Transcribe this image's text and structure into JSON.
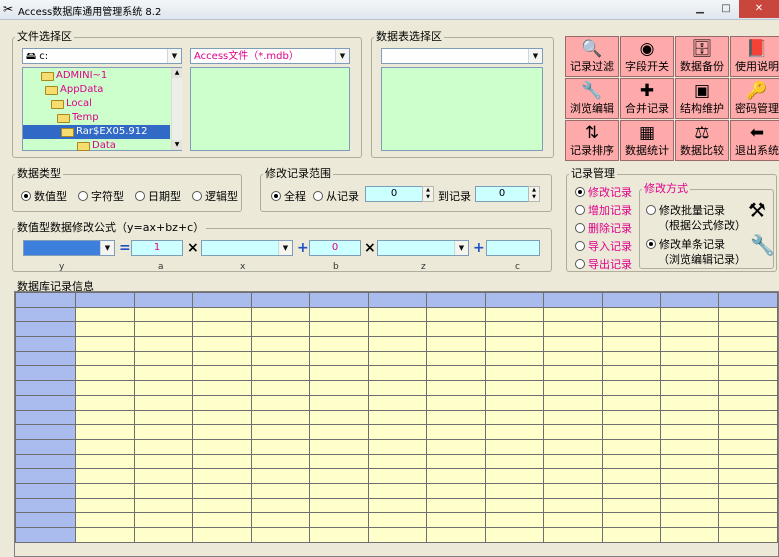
{
  "window": {
    "title": "Access数据库通用管理系统 8.2"
  },
  "file_area": {
    "title": "文件选择区",
    "drive": "c:",
    "filter": "Access文件（*.mdb）",
    "tree": [
      "ADMINI~1",
      "AppData",
      "Local",
      "Temp",
      "Rar$EX05.912",
      "Data"
    ]
  },
  "table_area": {
    "title": "数据表选择区",
    "selected": ""
  },
  "toolbar": {
    "buttons": [
      {
        "label": "记录过滤",
        "icon": "magnifier-icon",
        "glyph": "🔍"
      },
      {
        "label": "字段开关",
        "icon": "toggle-switch-icon",
        "glyph": "◉"
      },
      {
        "label": "数据备份",
        "icon": "database-backup-icon",
        "glyph": "🗄"
      },
      {
        "label": "使用说明",
        "icon": "help-book-icon",
        "glyph": "📕"
      },
      {
        "label": "浏览编辑",
        "icon": "tools-icon",
        "glyph": "🔧"
      },
      {
        "label": "合并记录",
        "icon": "merge-arrows-icon",
        "glyph": "✚"
      },
      {
        "label": "结构维护",
        "icon": "structure-icon",
        "glyph": "▣"
      },
      {
        "label": "密码管理",
        "icon": "key-icon",
        "glyph": "🔑"
      },
      {
        "label": "记录排序",
        "icon": "sort-icon",
        "glyph": "⇅"
      },
      {
        "label": "数据统计",
        "icon": "calculator-icon",
        "glyph": "▦"
      },
      {
        "label": "数据比较",
        "icon": "compare-icon",
        "glyph": "⚖"
      },
      {
        "label": "退出系统",
        "icon": "exit-door-icon",
        "glyph": "⬅"
      }
    ]
  },
  "data_type": {
    "title": "数据类型",
    "options": [
      "数值型",
      "字符型",
      "日期型",
      "逻辑型"
    ],
    "selected": "数值型"
  },
  "modify_range": {
    "title": "修改记录范围",
    "all_label": "全程",
    "from_label": "从记录",
    "to_label": "到记录",
    "from_value": "0",
    "to_value": "0"
  },
  "formula": {
    "title": "数值型数据修改公式（y=ax+bz+c）",
    "a_value": "1",
    "b_value": "0",
    "c_value": "",
    "labels": [
      "y",
      "a",
      "x",
      "b",
      "z",
      "c"
    ],
    "equals": "=",
    "times": "×",
    "plus": "+"
  },
  "record_mgmt": {
    "title": "记录管理",
    "options": [
      "修改记录",
      "增加记录",
      "删除记录",
      "导入记录",
      "导出记录"
    ],
    "selected": "修改记录"
  },
  "modify_mode": {
    "title": "修改方式",
    "batch_label": "修改批量记录",
    "batch_sub": "（根据公式修改）",
    "single_label": "修改单条记录",
    "single_sub": "（浏览编辑记录）"
  },
  "records": {
    "title": "数据库记录信息"
  },
  "colors": {
    "tool_button": "#ffaaaa",
    "grid_cell": "#ffffcc",
    "grid_header": "#aabbee",
    "input_bg": "#ccffff",
    "list_bg": "#ccffcc"
  }
}
